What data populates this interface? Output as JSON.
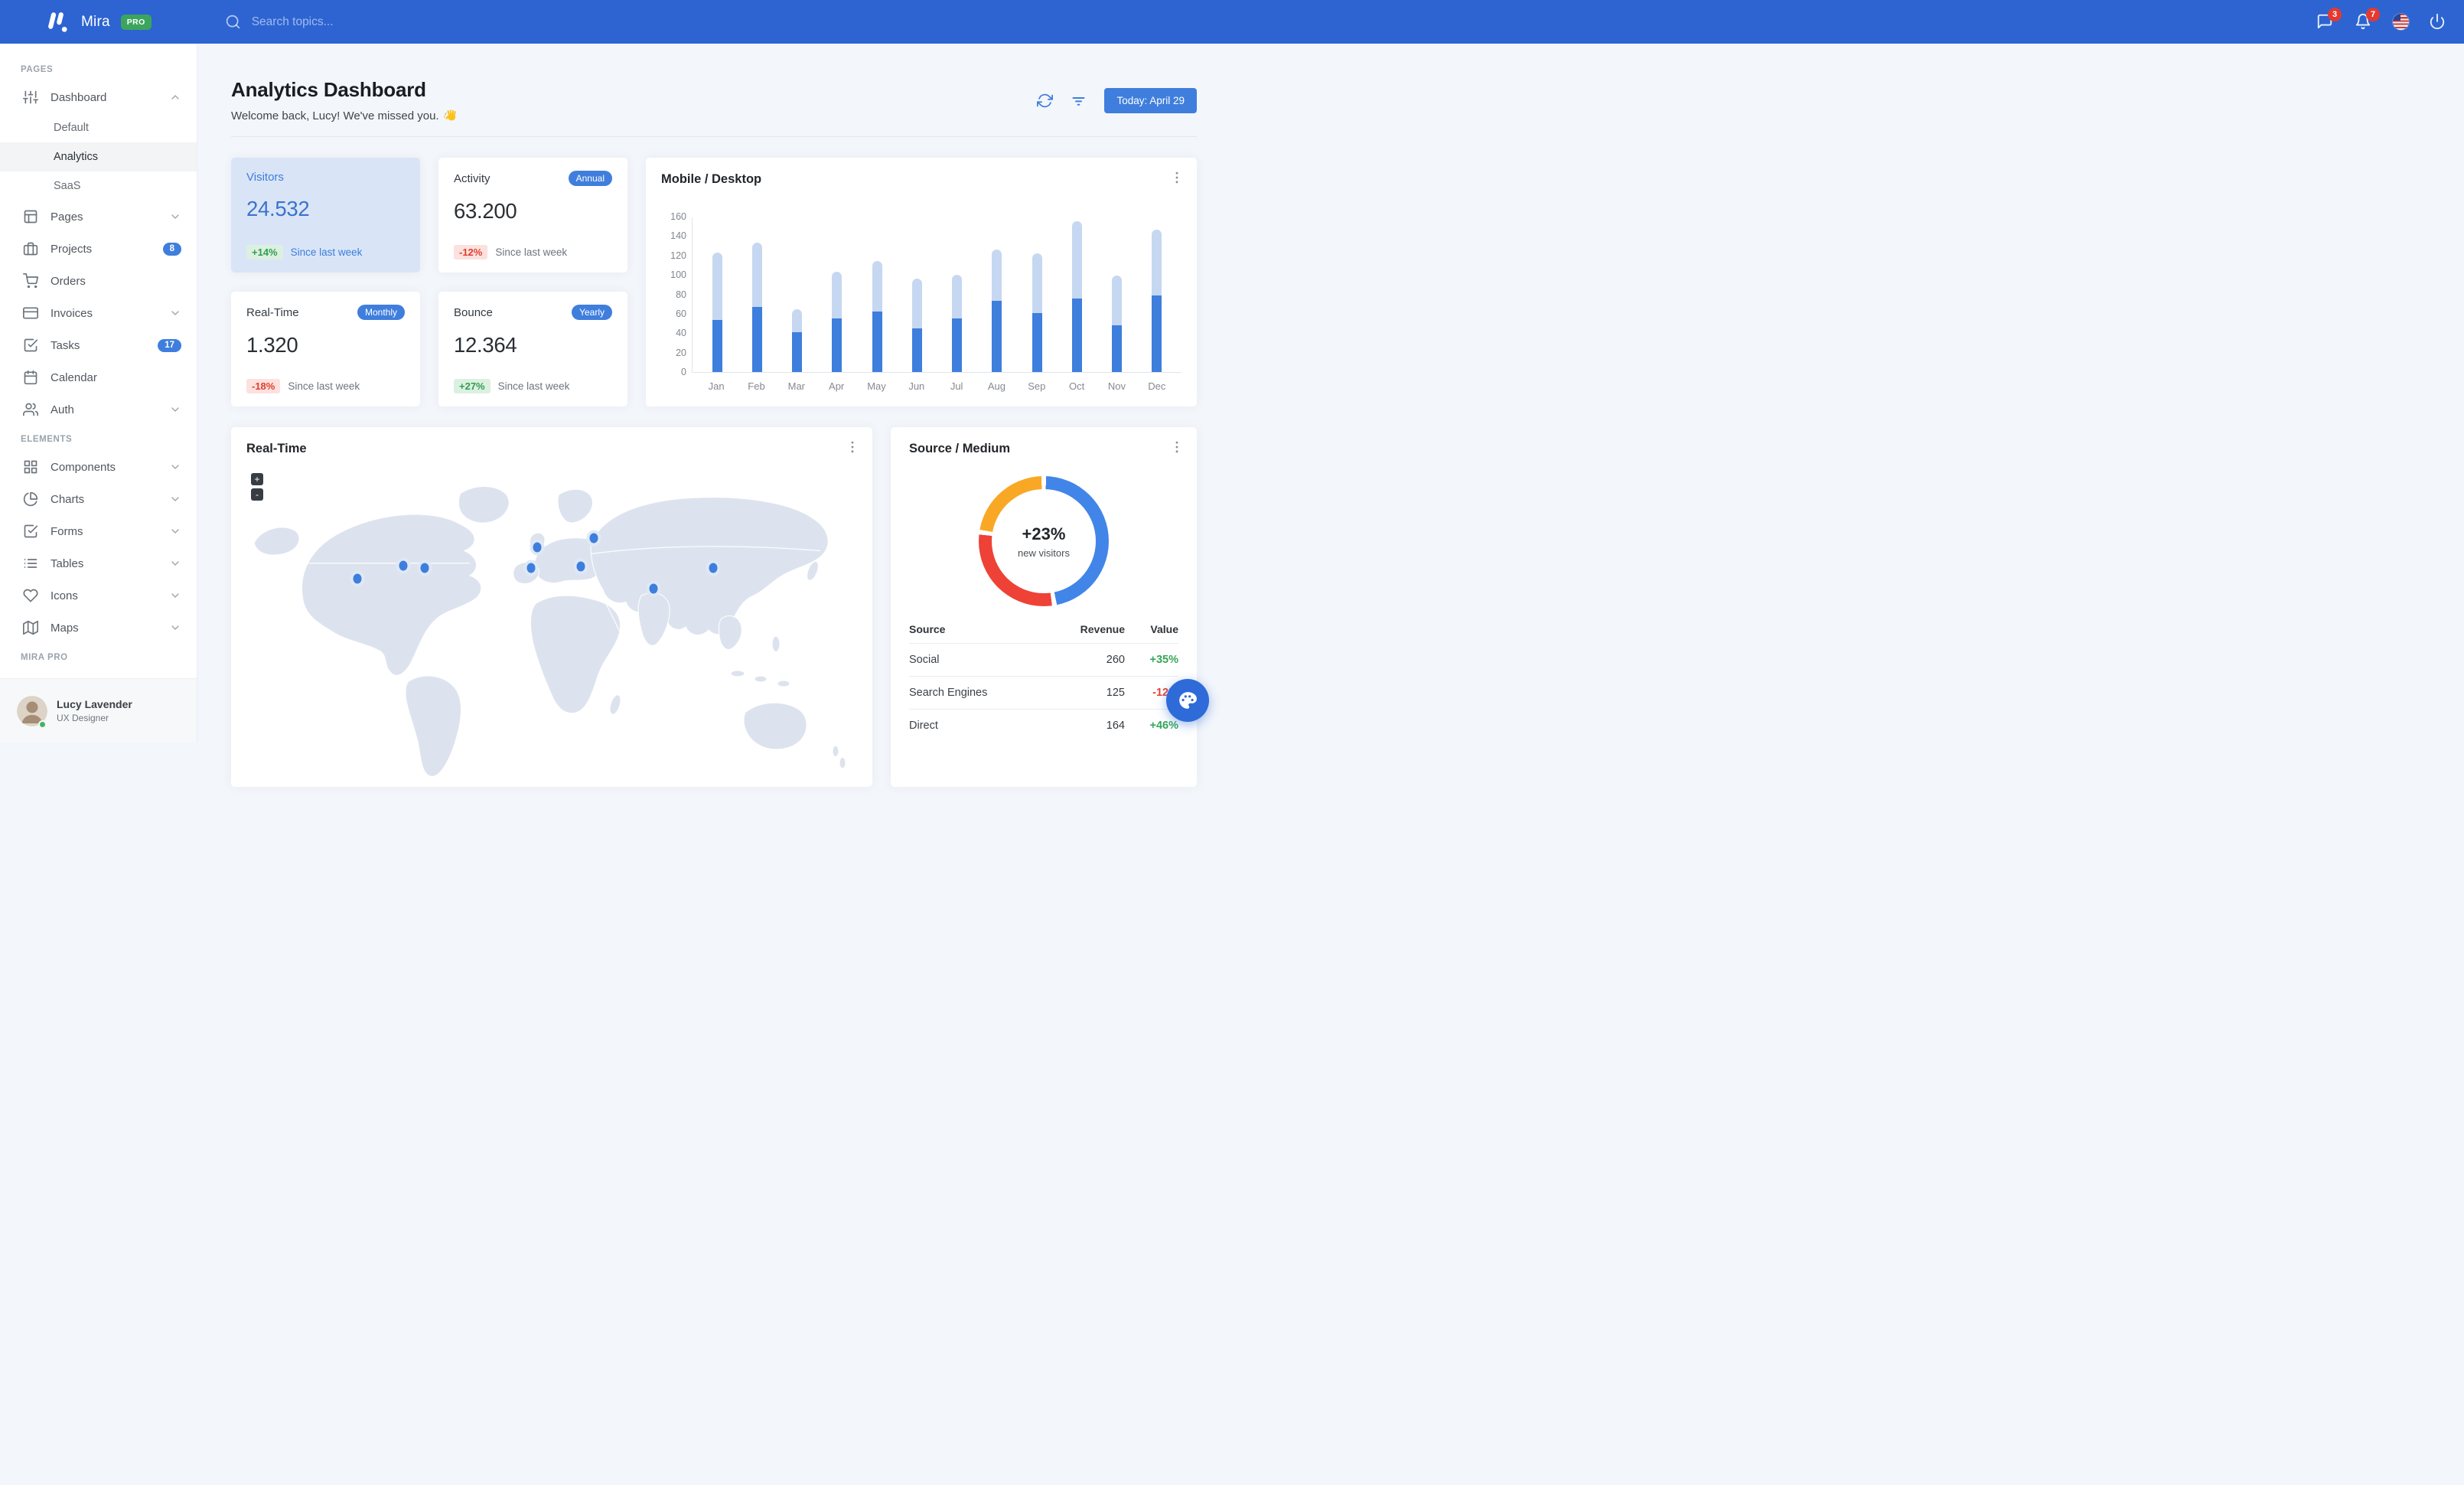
{
  "navbar": {
    "brand": "Mira",
    "brand_badge": "PRO",
    "search_placeholder": "Search topics...",
    "messages_badge": "3",
    "notifications_badge": "7"
  },
  "sidebar": {
    "sections": [
      {
        "label": "PAGES",
        "items": [
          {
            "icon": "sliders",
            "label": "Dashboard",
            "chevron": "up",
            "children": [
              {
                "label": "Default"
              },
              {
                "label": "Analytics",
                "active": true
              },
              {
                "label": "SaaS"
              }
            ]
          },
          {
            "icon": "layout",
            "label": "Pages",
            "chevron": "down"
          },
          {
            "icon": "briefcase",
            "label": "Projects",
            "badge": "8"
          },
          {
            "icon": "cart",
            "label": "Orders"
          },
          {
            "icon": "credit-card",
            "label": "Invoices",
            "chevron": "down"
          },
          {
            "icon": "check-square",
            "label": "Tasks",
            "badge": "17"
          },
          {
            "icon": "calendar",
            "label": "Calendar"
          },
          {
            "icon": "users",
            "label": "Auth",
            "chevron": "down"
          }
        ]
      },
      {
        "label": "ELEMENTS",
        "items": [
          {
            "icon": "grid",
            "label": "Components",
            "chevron": "down"
          },
          {
            "icon": "pie-chart",
            "label": "Charts",
            "chevron": "down"
          },
          {
            "icon": "check-square",
            "label": "Forms",
            "chevron": "down"
          },
          {
            "icon": "list",
            "label": "Tables",
            "chevron": "down"
          },
          {
            "icon": "heart",
            "label": "Icons",
            "chevron": "down"
          },
          {
            "icon": "map",
            "label": "Maps",
            "chevron": "down"
          }
        ]
      },
      {
        "label": "MIRA PRO",
        "items": []
      }
    ],
    "user": {
      "name": "Lucy Lavender",
      "role": "UX Designer",
      "status": "online"
    }
  },
  "header": {
    "title": "Analytics Dashboard",
    "subtitle": "Welcome back, Lucy! We've missed you.",
    "wave_emoji": "👋",
    "date_button": "Today: April 29"
  },
  "stats": [
    {
      "title": "Visitors",
      "value": "24.532",
      "delta": "+14%",
      "delta_type": "positive",
      "caption": "Since last week",
      "variant": "highlight"
    },
    {
      "title": "Activity",
      "value": "63.200",
      "delta": "-12%",
      "delta_type": "negative",
      "caption": "Since last week",
      "badge": "Annual"
    },
    {
      "title": "Real-Time",
      "value": "1.320",
      "delta": "-18%",
      "delta_type": "negative",
      "caption": "Since last week",
      "badge": "Monthly"
    },
    {
      "title": "Bounce",
      "value": "12.364",
      "delta": "+27%",
      "delta_type": "positive",
      "caption": "Since last week",
      "badge": "Yearly"
    }
  ],
  "chart_data": [
    {
      "type": "bar",
      "title": "Mobile / Desktop",
      "stacked": true,
      "categories": [
        "Jan",
        "Feb",
        "Mar",
        "Apr",
        "May",
        "Jun",
        "Jul",
        "Aug",
        "Sep",
        "Oct",
        "Nov",
        "Dec"
      ],
      "series": [
        {
          "name": "Mobile",
          "color": "#3e7edc",
          "values": [
            54,
            67,
            41,
            55,
            62,
            45,
            55,
            73,
            61,
            76,
            48,
            79
          ]
        },
        {
          "name": "Desktop",
          "color": "#c6d7f2",
          "values": [
            69,
            66,
            24,
            48,
            52,
            51,
            45,
            53,
            61,
            79,
            51,
            68
          ]
        }
      ],
      "xlabel": "",
      "ylabel": "",
      "ylim": [
        0,
        160
      ],
      "yticks": [
        0,
        20,
        40,
        60,
        80,
        100,
        120,
        140,
        160
      ],
      "grid": false,
      "legend": "none"
    },
    {
      "type": "donut",
      "title": "Source / Medium",
      "center_value": "+23%",
      "center_label": "new visitors",
      "segments": [
        {
          "label": "Social",
          "value": 260,
          "color": "#4285e8"
        },
        {
          "label": "Direct",
          "value": 164,
          "color": "#ee4237"
        },
        {
          "label": "Search Engines",
          "value": 125,
          "color": "#f9a825"
        }
      ]
    }
  ],
  "map_card": {
    "title": "Real-Time",
    "zoom_in_label": "+",
    "zoom_out_label": "-",
    "markers": [
      {
        "x": 19.7,
        "y": 34.5
      },
      {
        "x": 26.9,
        "y": 30.3
      },
      {
        "x": 30.2,
        "y": 31.0
      },
      {
        "x": 47.7,
        "y": 24.4
      },
      {
        "x": 46.8,
        "y": 31.0
      },
      {
        "x": 56.6,
        "y": 21.4
      },
      {
        "x": 54.5,
        "y": 30.5
      },
      {
        "x": 65.9,
        "y": 37.7
      },
      {
        "x": 75.2,
        "y": 31.0
      }
    ]
  },
  "source_card": {
    "title": "Source / Medium",
    "table": {
      "headers": [
        "Source",
        "Revenue",
        "Value"
      ],
      "rows": [
        {
          "source": "Social",
          "revenue": "260",
          "value": "+35%",
          "value_type": "positive"
        },
        {
          "source": "Search Engines",
          "revenue": "125",
          "value": "-12%",
          "value_type": "negative"
        },
        {
          "source": "Direct",
          "revenue": "164",
          "value": "+46%",
          "value_type": "positive"
        }
      ]
    }
  },
  "colors": {
    "navbar": "#2d64d2",
    "primary": "#3f7edd",
    "highlight_card": "#d9e5f6",
    "positive": "#2f9e4f",
    "negative": "#ea4335",
    "bar_dark": "#3e7edc",
    "bar_light": "#c6d7f2",
    "donut_blue": "#4285e8",
    "donut_red": "#ee4237",
    "donut_orange": "#f9a825",
    "land": "#dde3ee"
  }
}
